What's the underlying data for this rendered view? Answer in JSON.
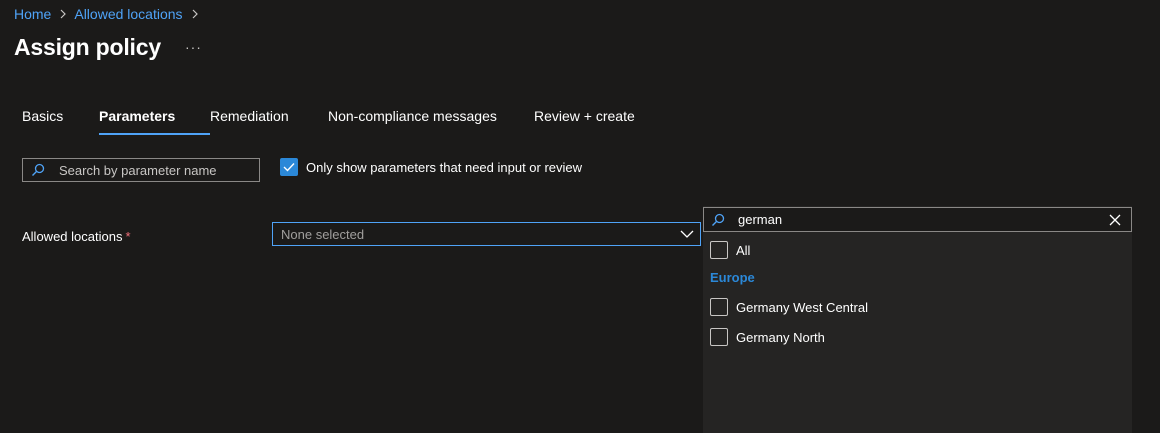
{
  "breadcrumb": {
    "home": "Home",
    "allowed_locations": "Allowed locations"
  },
  "page": {
    "title": "Assign policy",
    "more": "···"
  },
  "tabs": [
    {
      "label": "Basics",
      "active": false
    },
    {
      "label": "Parameters",
      "active": true
    },
    {
      "label": "Remediation",
      "active": false
    },
    {
      "label": "Non-compliance messages",
      "active": false
    },
    {
      "label": "Review + create",
      "active": false
    }
  ],
  "filters": {
    "search_placeholder": "Search by parameter name",
    "only_show_label": "Only show parameters that need input or review",
    "only_show_checked": true
  },
  "allowed_locations": {
    "label": "Allowed locations",
    "required_marker": "*",
    "value": "None selected"
  },
  "location_picker": {
    "search_value": "german",
    "all_label": "All",
    "group": "Europe",
    "options": [
      "Germany West Central",
      "Germany North"
    ]
  },
  "colors": {
    "accent": "#4fa3f7",
    "checkbox": "#2b88d8",
    "background": "#1b1a19",
    "panel": "#252423",
    "required": "#f1707b"
  },
  "icons": [
    "chevron-right-icon",
    "more-icon",
    "search-icon",
    "checkmark-icon",
    "chevron-down-icon",
    "close-icon"
  ]
}
